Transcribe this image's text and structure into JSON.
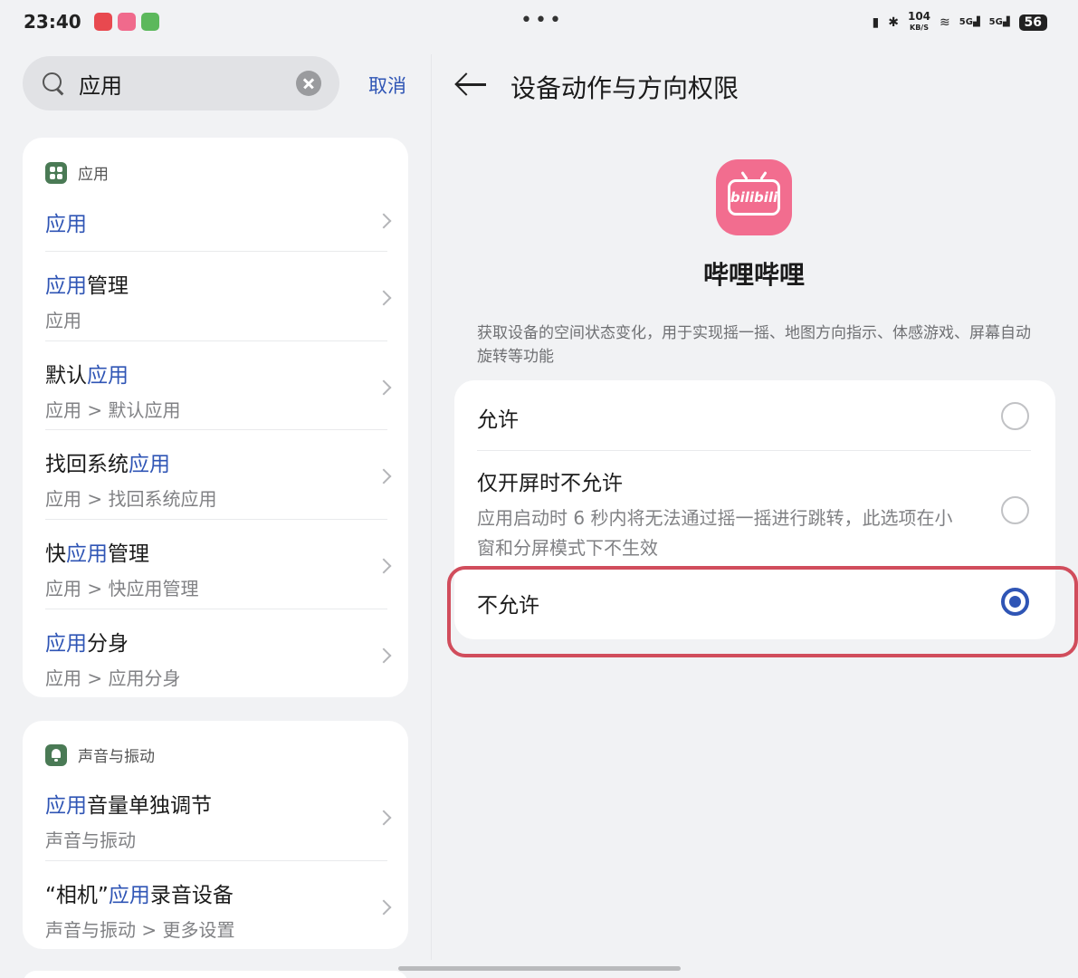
{
  "status_bar": {
    "time": "23:40",
    "notification_colors": [
      "#e8494f",
      "#f06a8c",
      "#5cb85c"
    ],
    "dots": "•••",
    "network_speed": "104",
    "speed_unit": "KB/S",
    "signal_1_label": "5G",
    "signal_2_label": "5G",
    "battery": "56"
  },
  "search": {
    "query": "应用",
    "cancel_label": "取消"
  },
  "results": [
    {
      "section": "应用",
      "items": [
        {
          "highlight": "应用",
          "rest": "",
          "prefix": "",
          "sub": ""
        },
        {
          "highlight": "应用",
          "rest": "管理",
          "prefix": "",
          "sub": "应用"
        },
        {
          "prefix": "默认",
          "highlight": "应用",
          "rest": "",
          "sub": "应用 > 默认应用"
        },
        {
          "prefix": "找回系统",
          "highlight": "应用",
          "rest": "",
          "sub": "应用 > 找回系统应用"
        },
        {
          "prefix": "快",
          "highlight": "应用",
          "rest": "管理",
          "sub": "应用 > 快应用管理"
        },
        {
          "highlight": "应用",
          "rest": "分身",
          "prefix": "",
          "sub": "应用 > 应用分身"
        }
      ]
    },
    {
      "section": "声音与振动",
      "items": [
        {
          "highlight": "应用",
          "rest": "音量单独调节",
          "prefix": "",
          "sub": "声音与振动"
        },
        {
          "prefix": "“相机”",
          "highlight": "应用",
          "rest": "录音设备",
          "sub": "声音与振动 > 更多设置"
        }
      ]
    }
  ],
  "detail": {
    "title": "设备动作与方向权限",
    "app_logo_text": "bilibili",
    "app_name": "哔哩哔哩",
    "description": "获取设备的空间状态变化，用于实现摇一摇、地图方向指示、体感游戏、屏幕自动旋转等功能",
    "options": [
      {
        "label": "允许",
        "sub": ""
      },
      {
        "label": "仅开屏时不允许",
        "sub": "应用启动时 6 秒内将无法通过摇一摇进行跳转，此选项在小窗和分屏模式下不生效"
      },
      {
        "label": "不允许",
        "sub": ""
      }
    ],
    "selected_option": "不允许",
    "accent_color": "#2f55b5",
    "highlight_color": "#d14d5c"
  }
}
